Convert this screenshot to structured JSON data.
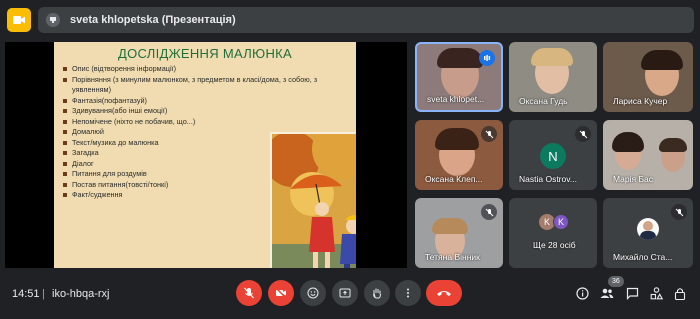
{
  "presenter_bar": {
    "text": "sveta khlopetska (Презентація)"
  },
  "slide": {
    "title": "ДОСЛІДЖЕННЯ МАЛЮНКА",
    "bullets": [
      "Опис (відтворення інформації)",
      "Порівняння (з минулим малюнком, з предметом в класі/дома, з собою, з уявленням)",
      "Фантазія(пофантазуй)",
      "Здивування(або інші емоції)",
      "Непомічене (ніхто не побачив, що...)",
      "Домалюй",
      "Текст/музика до малюнка",
      "Загадка",
      "Діалог",
      "Питання для роздумів",
      "Постав питання(товсті/тонкі)",
      "Факт/судження"
    ]
  },
  "participants": [
    {
      "name": "sveta khlopet...",
      "speaking": true
    },
    {
      "name": "Оксана Гудь"
    },
    {
      "name": "Лариса Кучер"
    },
    {
      "name": "Оксана Клеп..."
    },
    {
      "name": "Nastia Ostrov...",
      "initial": "N"
    },
    {
      "name": "Марія Бас"
    },
    {
      "name": "Тетяна Вінник"
    },
    {
      "name": "Ще 28 осіб",
      "initials": [
        "K",
        "K"
      ]
    },
    {
      "name": "Михайло Ста..."
    }
  ],
  "footer": {
    "time": "14:51",
    "separator": "|",
    "meeting_code": "iko-hbqa-rxj",
    "participant_count": "36"
  },
  "icons": {
    "mic_off": "mic-off-icon",
    "cam_off": "camera-off-icon",
    "emoji": "emoji-icon",
    "present": "present-screen-icon",
    "hand": "raise-hand-icon",
    "more": "more-vert-icon",
    "leave": "call-end-icon",
    "info": "info-icon",
    "people": "people-icon",
    "chat": "chat-icon",
    "activities": "activities-icon",
    "lock": "host-controls-icon"
  },
  "colors": {
    "accent": "#8ab4f8",
    "danger": "#ea4335",
    "brand": "#fbbc04",
    "green_initial": "#0b7a5f"
  }
}
